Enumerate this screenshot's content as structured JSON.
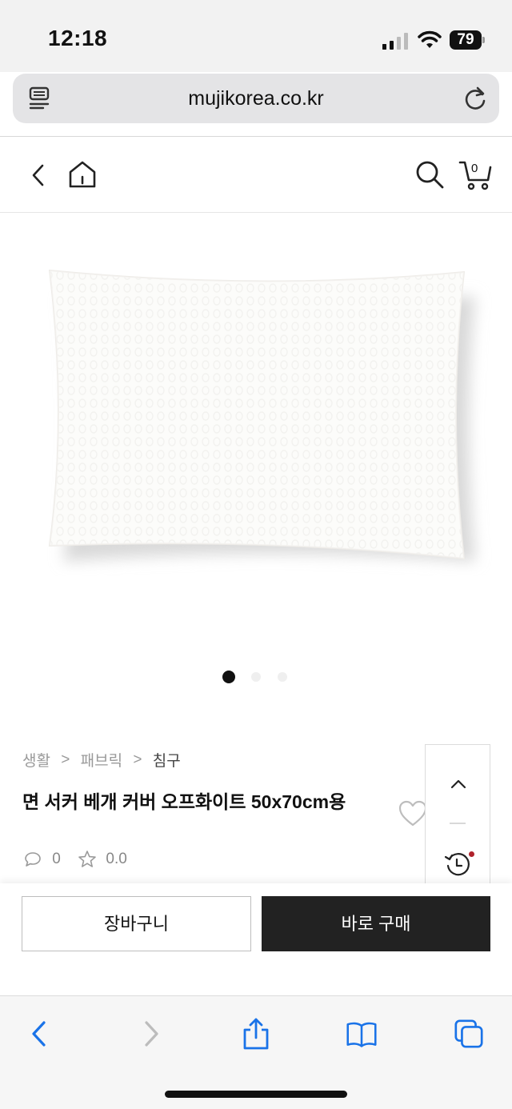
{
  "status_bar": {
    "time": "12:18",
    "battery": "79",
    "icons": [
      "signal-icon",
      "wifi-icon",
      "battery-icon"
    ]
  },
  "browser": {
    "url": "mujikorea.co.kr",
    "toolbar_icons": [
      "back-icon",
      "forward-icon",
      "share-icon",
      "bookmarks-icon",
      "tabs-icon"
    ],
    "accent_color": "#1a73e8"
  },
  "header": {
    "cart_count": "0",
    "icons": [
      "back-icon",
      "home-icon",
      "search-icon",
      "cart-icon"
    ]
  },
  "carousel": {
    "total_slides": 3,
    "active_slide": 1
  },
  "breadcrumb": {
    "items": [
      "생활",
      "패브릭",
      "침구"
    ],
    "separator": ">"
  },
  "product": {
    "title": "면 서커 베개 커버 오프화이트 50x70cm용",
    "review_count": "0",
    "rating": "0.0"
  },
  "actions": {
    "add_to_cart": "장바구니",
    "buy_now": "바로 구매"
  },
  "side_panel": {
    "icons": [
      "scroll-up-icon",
      "recent-history-icon"
    ]
  },
  "colors": {
    "buy_button": "#222222",
    "notification_dot": "#b0222c"
  }
}
